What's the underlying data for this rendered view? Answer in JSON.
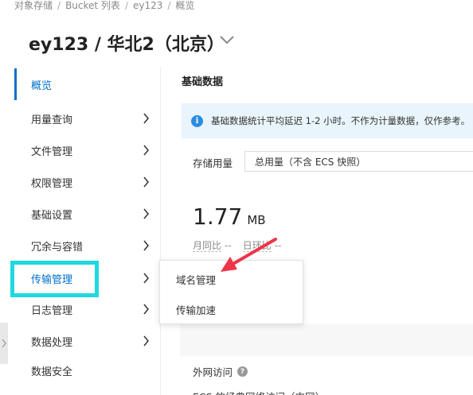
{
  "breadcrumb": {
    "items": [
      "对象存储",
      "Bucket 列表",
      "ey123",
      "概览"
    ],
    "separator": "/"
  },
  "header": {
    "title": "ey123 / 华北2（北京）"
  },
  "sidebar": {
    "items": [
      {
        "label": "概览"
      },
      {
        "label": "用量查询"
      },
      {
        "label": "文件管理"
      },
      {
        "label": "权限管理"
      },
      {
        "label": "基础设置"
      },
      {
        "label": "冗余与容错"
      },
      {
        "label": "传输管理"
      },
      {
        "label": "日志管理"
      },
      {
        "label": "数据处理"
      },
      {
        "label": "数据安全"
      }
    ]
  },
  "main": {
    "section_title": "基础数据",
    "info_text": "基础数据统计平均延迟 1-2 小时。不作为计量数据，仅作参考。",
    "storage_label": "存储用量",
    "storage_select_value": "总用量（不含 ECS 快照）",
    "storage_value": "1.77",
    "storage_unit": "MB",
    "compare": {
      "month_label": "月同比",
      "month_value": "--",
      "day_label": "日环比",
      "day_value": "--"
    },
    "external_access_label": "外网访问",
    "ecs_access_label": "ECS 的经典网络访问（内网）"
  },
  "popup_menu": {
    "items": [
      {
        "label": "域名管理"
      },
      {
        "label": "传输加速"
      }
    ]
  },
  "colors": {
    "accent": "#0070cc",
    "highlight_box": "#1fd8e0",
    "annotation_arrow": "#f0344a",
    "info_bar_bg": "#e9f4fc"
  },
  "icons": {
    "title_dropdown": "chevron-down-icon",
    "sidebar_expand": "chevron-right-icon",
    "info": "info-icon",
    "help": "question-icon"
  }
}
